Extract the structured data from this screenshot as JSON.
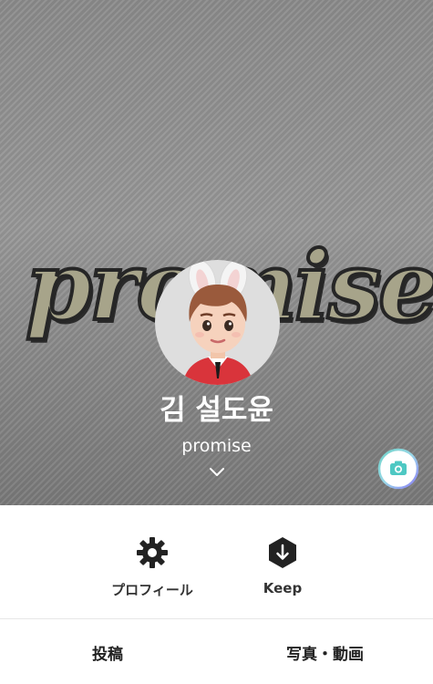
{
  "cover": {
    "word": "promise"
  },
  "profile": {
    "name": "김 설도윤",
    "status": "promise"
  },
  "actions": [
    {
      "label": "プロフィール",
      "icon": "gear-icon"
    },
    {
      "label": "Keep",
      "icon": "keep-icon"
    }
  ],
  "tabs": [
    {
      "label": "投稿"
    },
    {
      "label": "写真・動画"
    }
  ],
  "colors": {
    "camera_ring_start": "#6fd3c8",
    "camera_ring_end": "#8b7cf6",
    "camera_icon": "#4ec8c3",
    "icon_dark": "#222222"
  }
}
